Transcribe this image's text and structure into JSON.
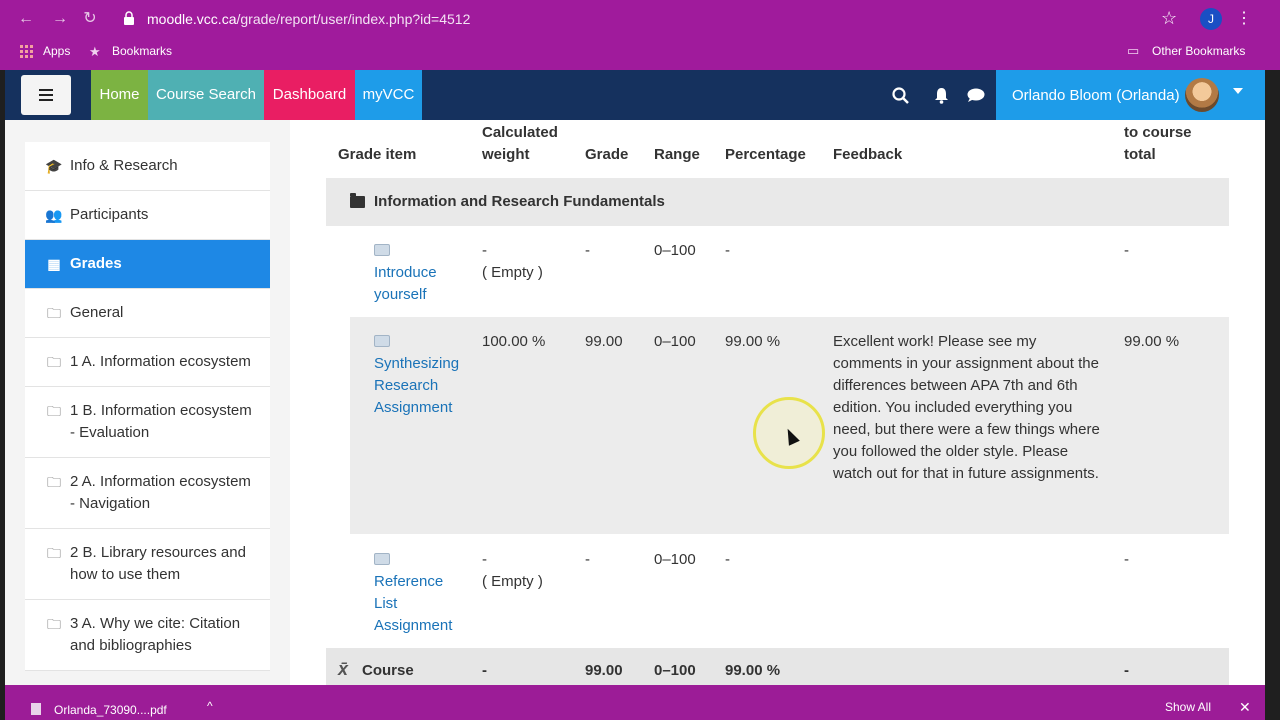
{
  "browser": {
    "url_host": "moodle.vcc.ca",
    "url_path": "/grade/report/user/index.php?id=4512",
    "profile_initial": "J",
    "bookmarks": {
      "apps": "Apps",
      "bookmarks": "Bookmarks",
      "other": "Other Bookmarks"
    }
  },
  "header": {
    "nav": {
      "home": "Home",
      "course_search": "Course Search",
      "dashboard": "Dashboard",
      "myvcc": "myVCC"
    },
    "user_name": "Orlando Bloom (Orlanda)"
  },
  "sidebar": {
    "items": [
      {
        "label": "Info & Research",
        "icon": "graduation-cap-icon"
      },
      {
        "label": "Participants",
        "icon": "users-icon"
      },
      {
        "label": "Grades",
        "icon": "table-icon"
      },
      {
        "label": "General",
        "icon": "folder-icon"
      },
      {
        "label": "1 A. Information ecosystem",
        "icon": "folder-icon"
      },
      {
        "label": "1 B. Information ecosystem - Evaluation",
        "icon": "folder-icon"
      },
      {
        "label": "2 A. Information ecosystem - Navigation",
        "icon": "folder-icon"
      },
      {
        "label": "2 B. Library resources and how to use them",
        "icon": "folder-icon"
      },
      {
        "label": "3 A. Why we cite: Citation and bibliographies",
        "icon": "folder-icon"
      }
    ]
  },
  "grades": {
    "columns": {
      "grade_item": "Grade item",
      "calc_weight": "Calculated weight",
      "grade": "Grade",
      "range": "Range",
      "percentage": "Percentage",
      "feedback": "Feedback",
      "contribution": "to course total"
    },
    "category": "Information and Research Fundamentals",
    "rows": [
      {
        "item": "Introduce yourself",
        "weight": "-",
        "weight_note": "( Empty )",
        "grade": "-",
        "range": "0–100",
        "percentage": "-",
        "feedback": "",
        "contribution": "-"
      },
      {
        "item": "Synthesizing Research Assignment",
        "weight": "100.00 %",
        "weight_note": "",
        "grade": "99.00",
        "range": "0–100",
        "percentage": "99.00 %",
        "feedback": "Excellent work! Please see my comments in your assignment about the differences between APA 7th and 6th edition. You included everything you need, but there were a few things where you followed the older style. Please watch out for that in future assignments.",
        "contribution": "99.00 %"
      },
      {
        "item": "Reference List Assignment",
        "weight": "-",
        "weight_note": "( Empty )",
        "grade": "-",
        "range": "0–100",
        "percentage": "-",
        "feedback": "",
        "contribution": "-"
      }
    ],
    "total": {
      "label": "Course",
      "weight": "-",
      "grade": "99.00",
      "range": "0–100",
      "percentage": "99.00 %",
      "contribution": "-"
    }
  },
  "downloads": {
    "file": "Orlanda_73090....pdf",
    "show_all": "Show All"
  },
  "colors": {
    "browser": "#a01b9c",
    "header": "#15315e",
    "home": "#7cb342",
    "course_search": "#4fb0b3",
    "dashboard": "#e91e63",
    "myvcc": "#1e9ce9",
    "active": "#1e88e5",
    "link": "#1a73b8"
  }
}
